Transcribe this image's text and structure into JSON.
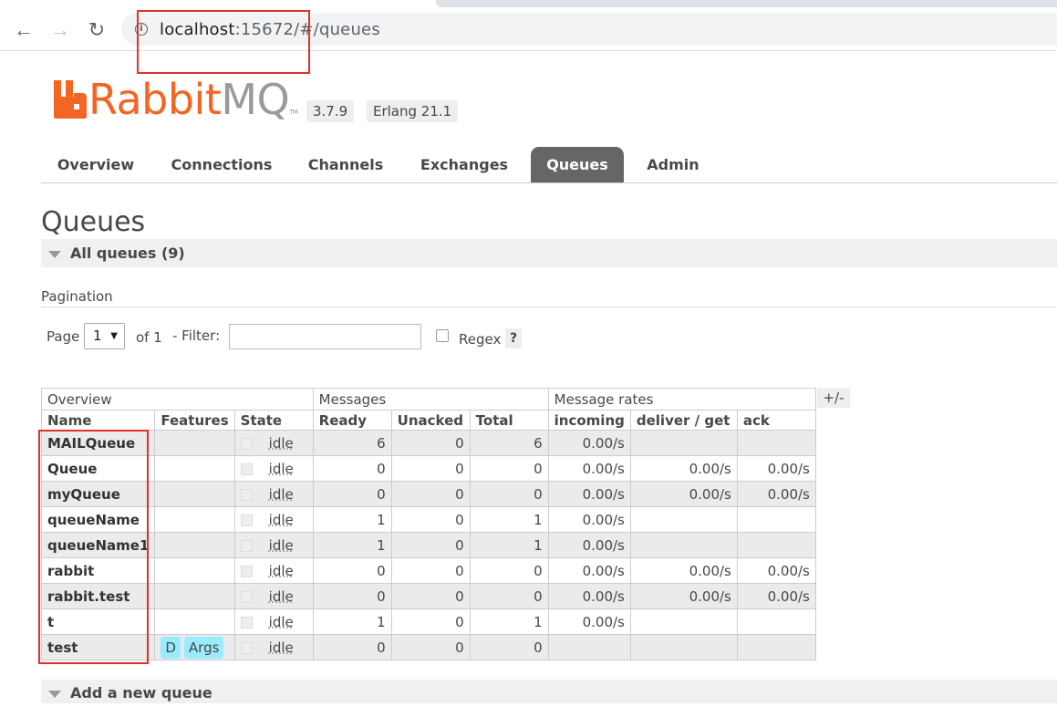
{
  "browser": {
    "back_icon": "←",
    "forward_icon": "→",
    "reload_icon": "↻",
    "info_icon": "i",
    "url_host": "localhost",
    "url_path": ":15672/#/queues"
  },
  "header": {
    "logo_rabbit": "Rabbit",
    "logo_mq": "MQ",
    "logo_tm": "TM",
    "version": "3.7.9",
    "erlang": "Erlang 21.1"
  },
  "nav": {
    "items": [
      "Overview",
      "Connections",
      "Channels",
      "Exchanges",
      "Queues",
      "Admin"
    ],
    "active": "Queues"
  },
  "page": {
    "title": "Queues",
    "all_queues_label": "All queues (9)",
    "add_queue_label": "Add a new queue"
  },
  "pagination": {
    "title": "Pagination",
    "page_label": "Page",
    "page_value": "1",
    "of_label": "of 1",
    "filter_label": "- Filter:",
    "filter_value": "",
    "regex_label": "Regex",
    "help_label": "?"
  },
  "table": {
    "group_headers": [
      "Overview",
      "Messages",
      "Message rates"
    ],
    "columns": [
      "Name",
      "Features",
      "State",
      "Ready",
      "Unacked",
      "Total",
      "incoming",
      "deliver / get",
      "ack"
    ],
    "plus_minus": "+/-",
    "rows": [
      {
        "name": "MAILQueue",
        "features": [],
        "state": "idle",
        "ready": "6",
        "unacked": "0",
        "total": "6",
        "incoming": "0.00/s",
        "deliver": "",
        "ack": ""
      },
      {
        "name": "Queue",
        "features": [],
        "state": "idle",
        "ready": "0",
        "unacked": "0",
        "total": "0",
        "incoming": "0.00/s",
        "deliver": "0.00/s",
        "ack": "0.00/s"
      },
      {
        "name": "myQueue",
        "features": [],
        "state": "idle",
        "ready": "0",
        "unacked": "0",
        "total": "0",
        "incoming": "0.00/s",
        "deliver": "0.00/s",
        "ack": "0.00/s"
      },
      {
        "name": "queueName",
        "features": [],
        "state": "idle",
        "ready": "1",
        "unacked": "0",
        "total": "1",
        "incoming": "0.00/s",
        "deliver": "",
        "ack": ""
      },
      {
        "name": "queueName1",
        "features": [],
        "state": "idle",
        "ready": "1",
        "unacked": "0",
        "total": "1",
        "incoming": "0.00/s",
        "deliver": "",
        "ack": ""
      },
      {
        "name": "rabbit",
        "features": [],
        "state": "idle",
        "ready": "0",
        "unacked": "0",
        "total": "0",
        "incoming": "0.00/s",
        "deliver": "0.00/s",
        "ack": "0.00/s"
      },
      {
        "name": "rabbit.test",
        "features": [],
        "state": "idle",
        "ready": "0",
        "unacked": "0",
        "total": "0",
        "incoming": "0.00/s",
        "deliver": "0.00/s",
        "ack": "0.00/s"
      },
      {
        "name": "t",
        "features": [],
        "state": "idle",
        "ready": "1",
        "unacked": "0",
        "total": "1",
        "incoming": "0.00/s",
        "deliver": "",
        "ack": ""
      },
      {
        "name": "test",
        "features": [
          "D",
          "Args"
        ],
        "state": "idle",
        "ready": "0",
        "unacked": "0",
        "total": "0",
        "incoming": "",
        "deliver": "",
        "ack": ""
      }
    ]
  },
  "colors": {
    "brand_orange": "#f26522",
    "brand_grey": "#9a9a9a",
    "active_tab": "#666666",
    "feature_badge": "#99ebff",
    "annotation_red": "#e0312b"
  }
}
